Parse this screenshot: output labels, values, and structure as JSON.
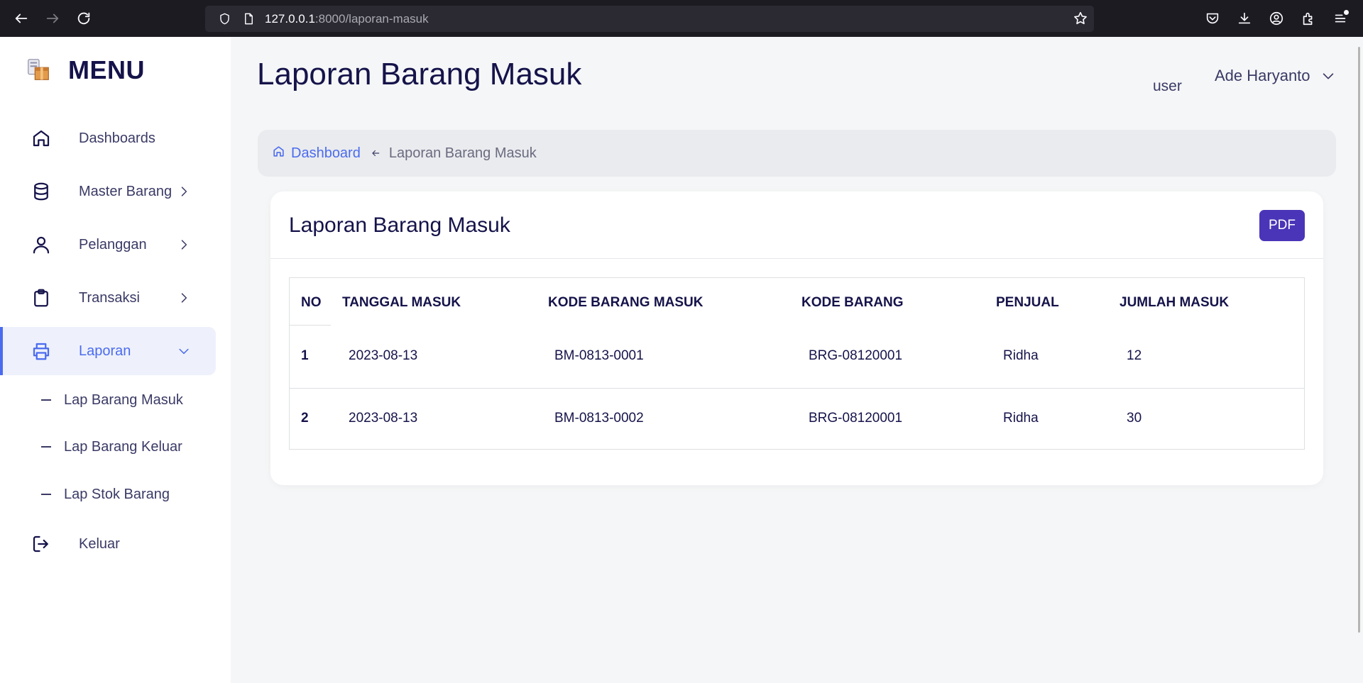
{
  "browser": {
    "url_host": "127.0.0.1",
    "url_path": ":8000/laporan-masuk"
  },
  "sidebar": {
    "brand": "MENU",
    "items": [
      {
        "label": "Dashboards",
        "icon": "home-icon"
      },
      {
        "label": "Master Barang",
        "icon": "database-icon"
      },
      {
        "label": "Pelanggan",
        "icon": "user-icon"
      },
      {
        "label": "Transaksi",
        "icon": "clipboard-icon"
      },
      {
        "label": "Laporan",
        "icon": "printer-icon",
        "active": true
      },
      {
        "label": "Keluar",
        "icon": "logout-icon"
      }
    ],
    "subitems": [
      {
        "label": "Lap Barang Masuk"
      },
      {
        "label": "Lap Barang Keluar"
      },
      {
        "label": "Lap Stok Barang"
      }
    ]
  },
  "header": {
    "title": "Laporan Barang Masuk",
    "role": "user",
    "username": "Ade Haryanto"
  },
  "breadcrumb": {
    "home": "Dashboard",
    "current": "Laporan Barang Masuk"
  },
  "card": {
    "title": "Laporan Barang Masuk",
    "pdf_label": "PDF"
  },
  "table": {
    "columns": [
      "NO",
      "TANGGAL MASUK",
      "KODE BARANG MASUK",
      "KODE BARANG",
      "PENJUAL",
      "JUMLAH MASUK"
    ],
    "rows": [
      [
        "1",
        "2023-08-13",
        "BM-0813-0001",
        "BRG-08120001",
        "Ridha",
        "12"
      ],
      [
        "2",
        "2023-08-13",
        "BM-0813-0002",
        "BRG-08120001",
        "Ridha",
        "30"
      ]
    ]
  },
  "colors": {
    "accent": "#4b6bef",
    "pdf_button": "#4a35b8",
    "heading": "#15134a"
  }
}
